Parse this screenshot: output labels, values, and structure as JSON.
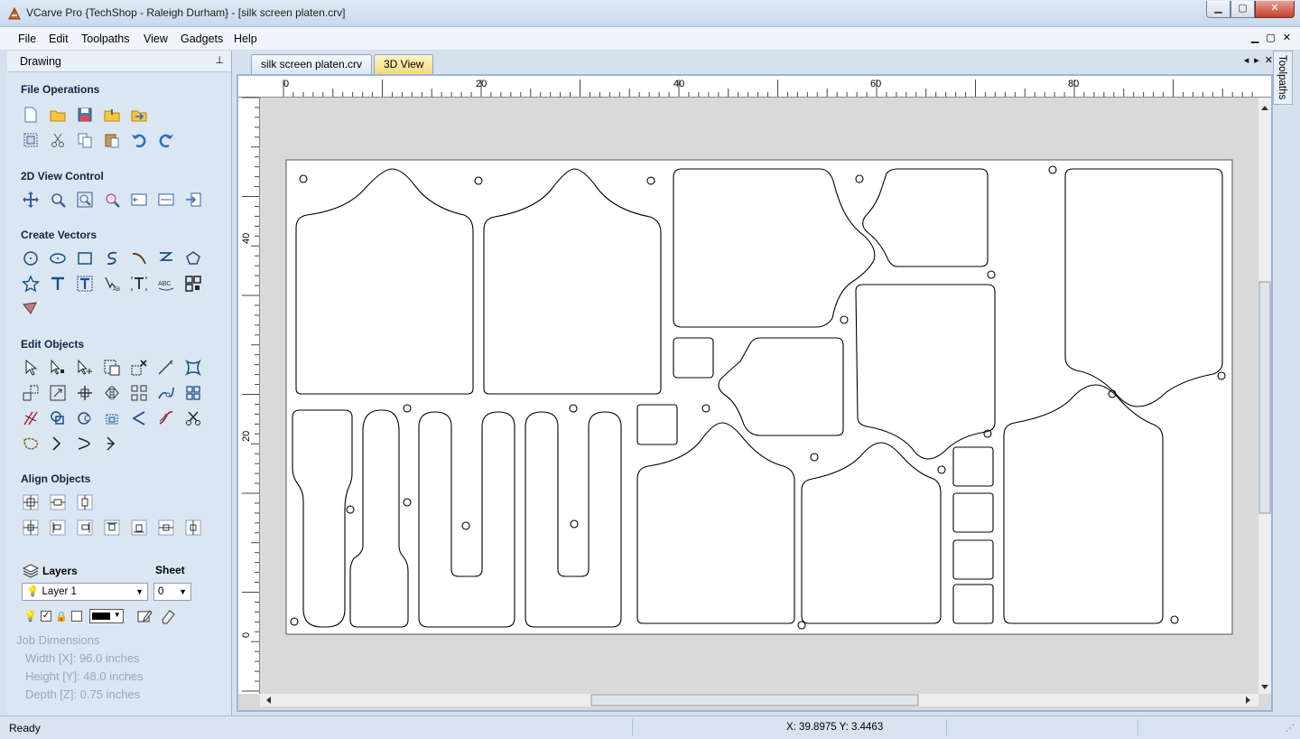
{
  "window": {
    "title": "VCarve Pro {TechShop - Raleigh Durham} - [silk screen platen.crv]",
    "buttons": [
      "▁",
      "▢",
      "✕"
    ]
  },
  "menu": {
    "items": [
      "File",
      "Edit",
      "Toolpaths",
      "View",
      "Gadgets",
      "Help"
    ],
    "mdi_buttons": [
      "▁",
      "▢",
      "✕"
    ]
  },
  "panel": {
    "header": "Drawing",
    "pin": "📌",
    "sections": {
      "file_operations": "File Operations",
      "view_control": "2D View Control",
      "create_vectors": "Create Vectors",
      "edit_objects": "Edit Objects",
      "align_objects": "Align Objects"
    },
    "layers": {
      "label": "Layers",
      "sheet_label": "Sheet",
      "layer_value": "Layer 1",
      "sheet_value": "0"
    },
    "job": {
      "title": "Job Dimensions",
      "width": "Width  [X]: 96.0 inches",
      "height": "Height [Y]: 48.0 inches",
      "depth": "Depth  [Z]: 0.75 inches"
    }
  },
  "tabs": {
    "active": "silk screen platen.crv",
    "inactive": "3D View",
    "nav": [
      "◂",
      "▸",
      "✕"
    ]
  },
  "rulers": {
    "top_ticks": [
      "0",
      "20",
      "40",
      "60",
      "80"
    ],
    "left_ticks": [
      "40",
      "20",
      "0"
    ]
  },
  "right_panel": {
    "label": "Toolpaths"
  },
  "status": {
    "text": "Ready",
    "coords": "X: 39.8975 Y:  3.4463"
  },
  "colors": {
    "accent": "#1d4d87",
    "panel_bg": "#dbe6f3",
    "sheet_bg": "#ffffff"
  }
}
